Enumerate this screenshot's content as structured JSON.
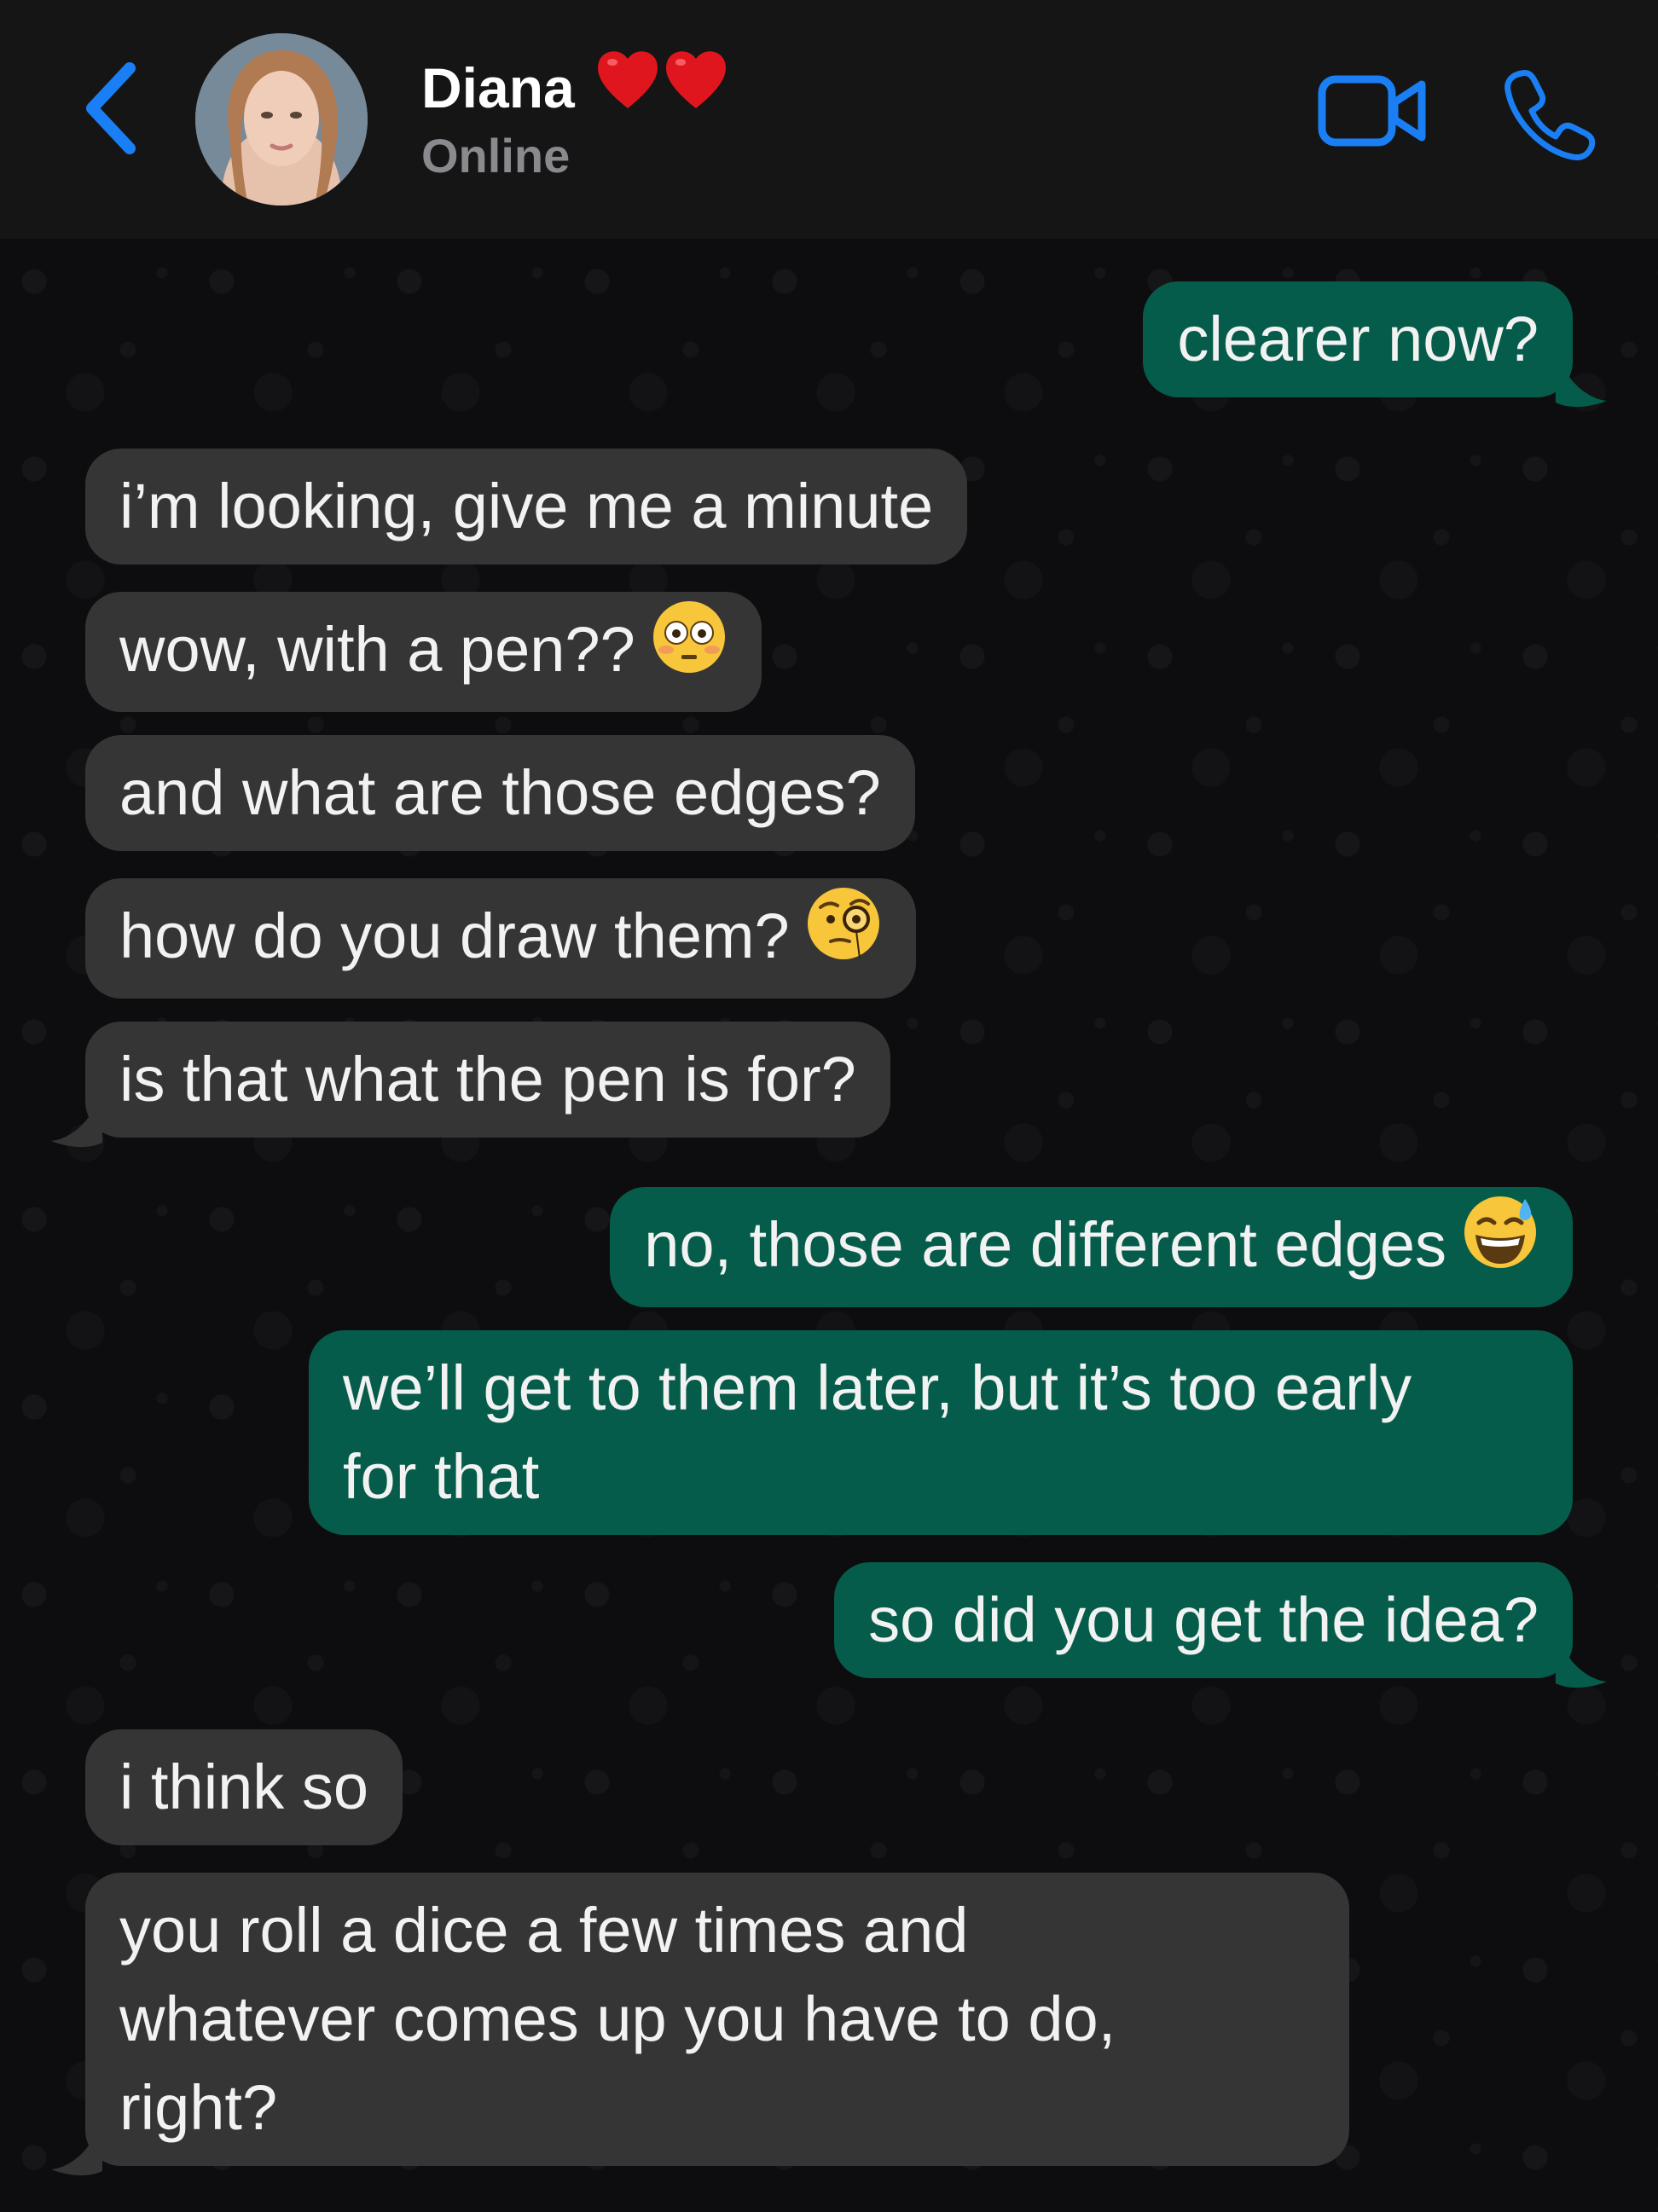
{
  "header": {
    "contact_name": "Diana",
    "name_emoji": "❤️❤️",
    "status": "Online",
    "accent_color": "#1a7ff5"
  },
  "icons": {
    "back": "chevron-left-icon",
    "video": "video-camera-icon",
    "call": "phone-icon"
  },
  "messages": [
    {
      "direction": "outgoing",
      "text": "clearer now?"
    },
    {
      "direction": "incoming",
      "text": "i’m looking, give me a minute"
    },
    {
      "direction": "incoming",
      "text": "wow, with a pen??",
      "emoji": "flushed-face"
    },
    {
      "direction": "incoming",
      "text": "and what are those edges?"
    },
    {
      "direction": "incoming",
      "text": "how do you draw them?",
      "emoji": "face-with-monocle"
    },
    {
      "direction": "incoming",
      "text": "is that what the pen is for?"
    },
    {
      "direction": "outgoing",
      "text": "no, those are different edges",
      "emoji": "grinning-face-with-sweat"
    },
    {
      "direction": "outgoing",
      "lines": [
        "we’ll get to them later, but it’s too early",
        "for that"
      ]
    },
    {
      "direction": "outgoing",
      "text": "so did you get the idea?"
    },
    {
      "direction": "incoming",
      "text": "i think so"
    },
    {
      "direction": "incoming",
      "lines": [
        "you roll a dice a few times and",
        "whatever comes up you have to do,",
        "right?"
      ]
    }
  ],
  "colors": {
    "incoming_bubble": "#353535",
    "outgoing_bubble": "#065c4a",
    "header_bg": "#151515",
    "chat_bg": "#0d0d10"
  }
}
